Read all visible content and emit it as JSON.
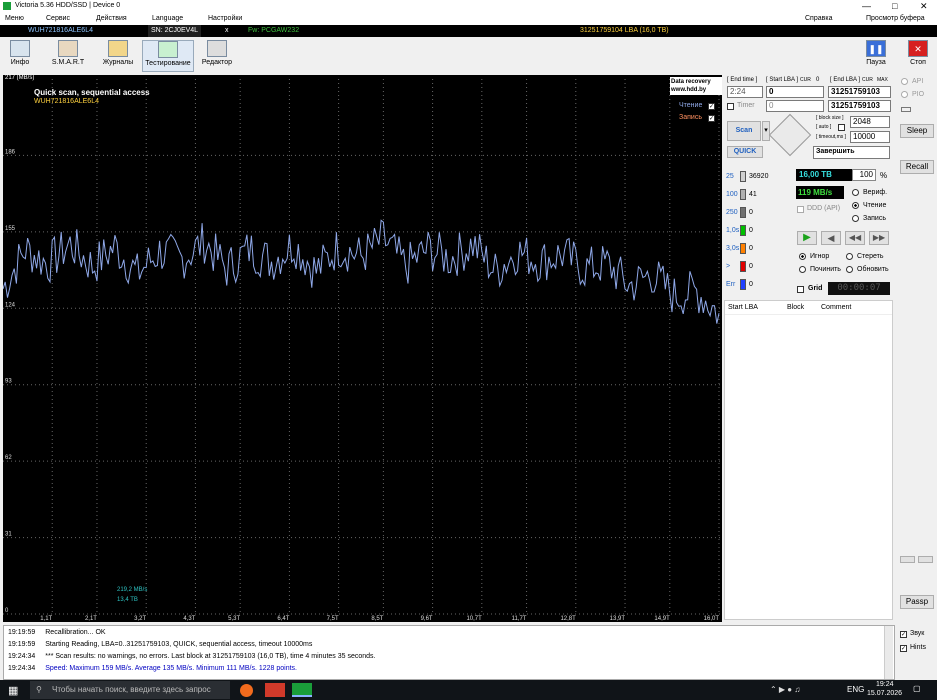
{
  "window": {
    "title": "Victoria 5.36 HDD/SSD | Device 0"
  },
  "menu": {
    "items": [
      "Меню",
      "Сервис",
      "Действия",
      "Language",
      "Настройки"
    ],
    "right": [
      "Справка",
      "Просмотр буфера"
    ]
  },
  "infobar": {
    "model": "WUH721816ALE6L4",
    "sn": "SN: 2CJ0EV4L",
    "close": "x",
    "fw": "Fw: PCGAW232",
    "capacity": "31251759104 LBA (16,0 TB)"
  },
  "toolbar": {
    "buttons": [
      "Инфо",
      "S.M.A.R.T",
      "Журналы",
      "Тестирование",
      "Редактор"
    ],
    "pause": "Пауза",
    "stop": "Стоп"
  },
  "chart": {
    "title": "Quick scan, sequential access",
    "model": "WUH721816ALE6L4",
    "ylabel": "217 (MB/s)",
    "yticks": [
      "186",
      "155",
      "124",
      "93",
      "62",
      "31",
      "0"
    ],
    "xticks": [
      "1,1T",
      "2,1T",
      "3,2T",
      "4,3T",
      "5,3T",
      "6,4T",
      "7,5T",
      "8,5T",
      "9,6T",
      "10,7T",
      "11,7T",
      "12,8T",
      "13,9T",
      "14,9T",
      "16,0T"
    ],
    "datarecovery": "Data recovery\nwww.hdd.by",
    "read_label": "Чтение",
    "write_label": "Запись",
    "speed_readout": "219,2 MB/s",
    "pos_readout": "13,4 TB"
  },
  "chart_data": {
    "type": "line",
    "title": "Quick scan, sequential access",
    "ylabel": "(MB/s)",
    "ylim": [
      0,
      217
    ],
    "xlim": [
      0,
      16.0
    ],
    "x": [
      0,
      0.5,
      1,
      1.5,
      2,
      2.5,
      3,
      3.5,
      4,
      4.5,
      5,
      5.5,
      6,
      6.5,
      7,
      7.5,
      8,
      8.5,
      9,
      9.5,
      10,
      10.5,
      11,
      11.5,
      12,
      12.5,
      13,
      13.5,
      14,
      14.5,
      15,
      15.5,
      16
    ],
    "y": [
      132,
      148,
      142,
      150,
      141,
      149,
      138,
      147,
      144,
      151,
      140,
      148,
      143,
      150,
      139,
      149,
      145,
      152,
      141,
      148,
      144,
      150,
      139,
      147,
      143,
      146,
      140,
      142,
      133,
      138,
      129,
      131,
      122
    ],
    "series_colors": [
      "#8fa8e8"
    ]
  },
  "rpanel": {
    "endtime_label": "[ End time ]",
    "startlba_label": "[ Start LBA ]",
    "cur_label": "CUR",
    "zero_label": "0",
    "endlba_label": "[ End LBA ]",
    "cur2": "CUR",
    "max": "MAX",
    "endtime": "2:24",
    "startlba": "0",
    "endlba": "31251759103",
    "timer_label": "Timer",
    "timer": "0",
    "endlba2": "31251759103",
    "blocksize_label": "[ block size ]",
    "auto_label": "[ auto ]",
    "blocksize": "2048",
    "timeout_label": "[ timeout,ms ]",
    "timeout": "10000",
    "scan": "Scan",
    "quick": "QUICK",
    "finish": "Завершить",
    "counts": [
      {
        "lbl": "25",
        "val": "36920",
        "color": "#d0d0d0"
      },
      {
        "lbl": "100",
        "val": "41",
        "color": "#b0b0b0"
      },
      {
        "lbl": "250",
        "val": "0",
        "color": "#707070"
      },
      {
        "lbl": "1,0s",
        "val": "0",
        "color": "#00c000"
      },
      {
        "lbl": "3,0s",
        "val": "0",
        "color": "#ff8000"
      },
      {
        "lbl": ">",
        "val": "0",
        "color": "#e00000"
      },
      {
        "lbl": "Err",
        "val": "0",
        "color": "#2040ff"
      }
    ],
    "size": "16,00 TB",
    "pct": "100",
    "pct_sign": "%",
    "speed": "119 MB/s",
    "verify": "Вериф.",
    "read": "Чтение",
    "write": "Запись",
    "ddd": "DDD (API)",
    "ignore": "Игнор",
    "erase": "Стереть",
    "repair": "Починить",
    "refresh": "Обновить",
    "grid": "Grid",
    "clock": "00:00:07",
    "table_headers": [
      "Start LBA",
      "Block",
      "Comment"
    ]
  },
  "farright": {
    "api": "API",
    "pio": "PIO",
    "sleep": "Sleep",
    "recall": "Recall",
    "passp": "Passp",
    "sound": "Звук",
    "hints": "Hints"
  },
  "log": [
    {
      "t": "19:19:59",
      "m": "Recallibration... OK",
      "c": "#000"
    },
    {
      "t": "19:19:59",
      "m": "Starting Reading, LBA=0..31251759103, QUICK, sequential access, timeout 10000ms",
      "c": "#000"
    },
    {
      "t": "19:24:34",
      "m": "*** Scan results: no warnings, no errors. Last block at 31251759103 (16,0 TB), time 4 minutes 35 seconds.",
      "c": "#000"
    },
    {
      "t": "19:24:34",
      "m": "Speed: Maximum 159 MB/s. Average 135 MB/s. Minimum 111 MB/s. 1228 points.",
      "c": "#0000c0"
    }
  ],
  "taskbar": {
    "search": "Чтобы начать поиск, введите здесь запрос",
    "lang": "ENG",
    "time": "19:24",
    "date": "15.07.2026"
  }
}
